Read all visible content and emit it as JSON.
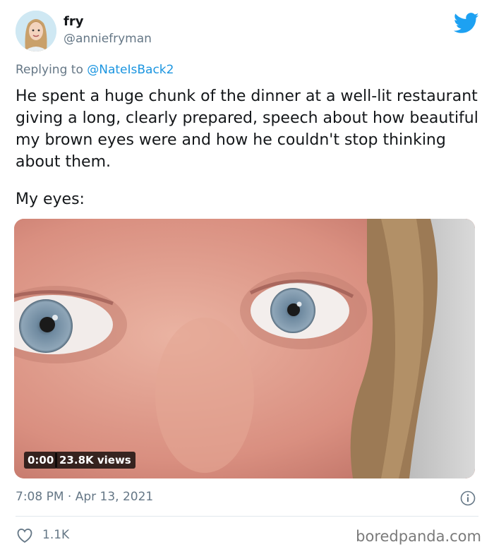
{
  "author": {
    "name": "fry",
    "handle": "@anniefryman"
  },
  "reply": {
    "prefix": "Replying to ",
    "mention": "@NateIsBack2"
  },
  "tweet": {
    "text": "He spent a huge chunk of the dinner at a well-lit restaurant giving a long, clearly prepared, speech about how beautiful my brown eyes were and how he couldn't stop thinking about them.",
    "caption": "My eyes:"
  },
  "media": {
    "time": "0:00",
    "views": "23.8K views"
  },
  "meta": {
    "timestamp": "7:08 PM · Apr 13, 2021",
    "likes": "1.1K"
  },
  "watermark": "boredpanda.com",
  "icons": {
    "brand": "twitter-bird-icon",
    "info": "info-icon",
    "like": "heart-icon"
  },
  "colors": {
    "link": "#1b95e0",
    "secondary_text": "#657786",
    "twitter_blue": "#1da1f2"
  }
}
